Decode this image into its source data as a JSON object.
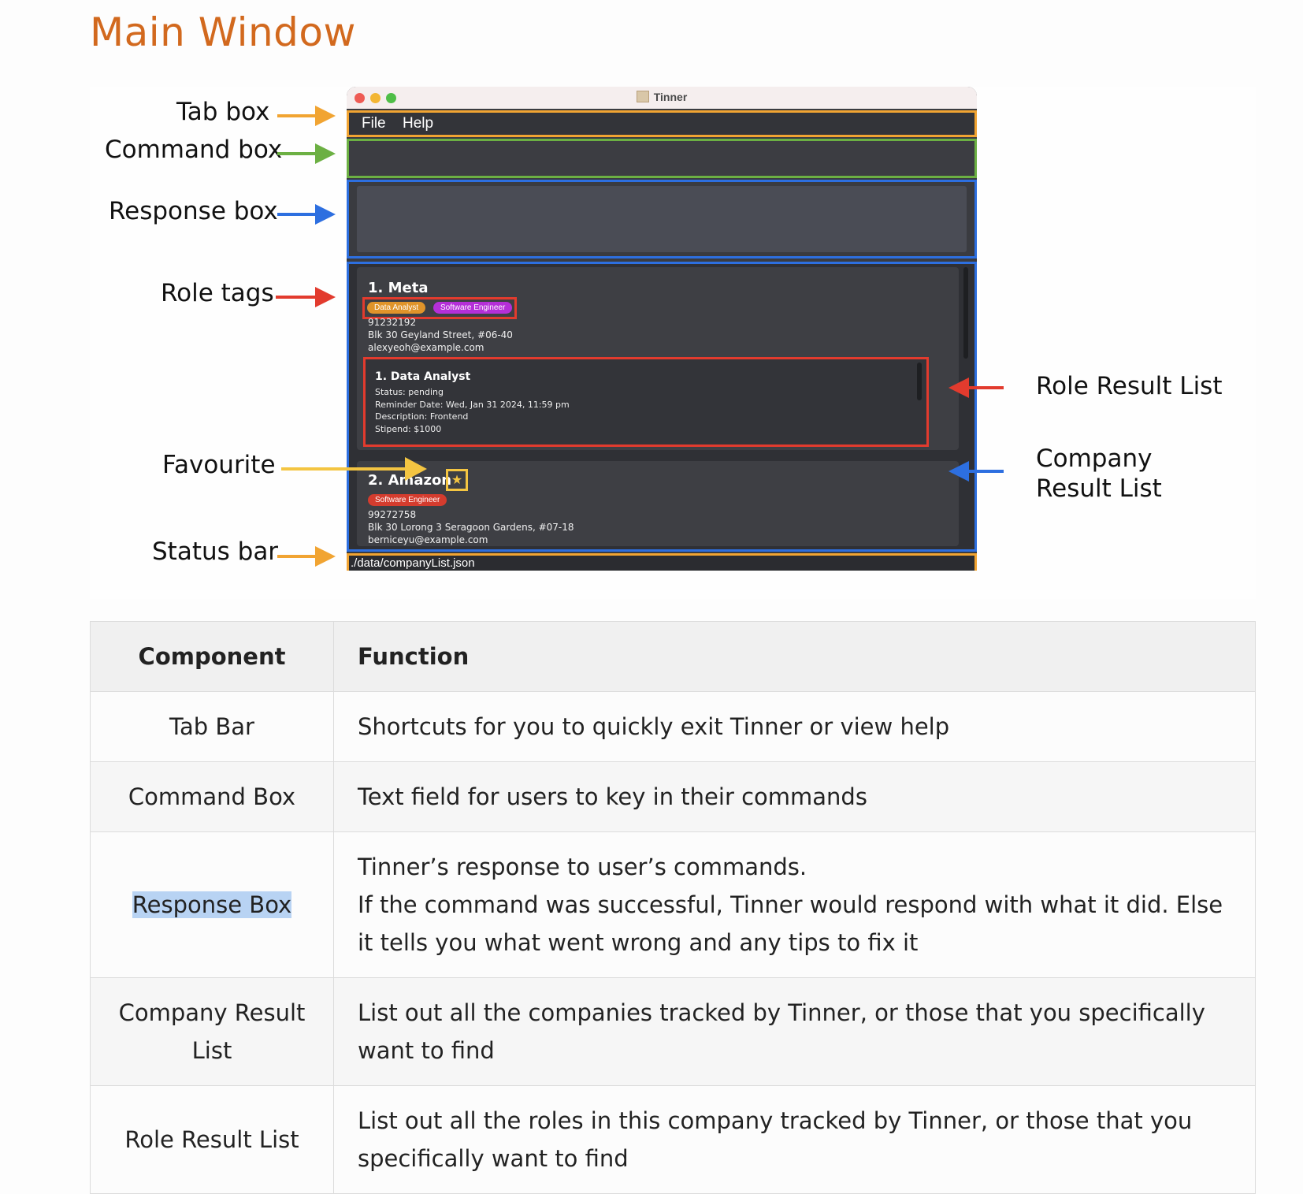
{
  "heading": "Main Window",
  "figure": {
    "window_title": "Tinner",
    "menu": [
      "File",
      "Help"
    ],
    "labels": {
      "tab_box": "Tab box",
      "command_box": "Command box",
      "response_box": "Response box",
      "role_tags": "Role tags",
      "favourite": "Favourite",
      "status_bar": "Status bar",
      "role_result_list": "Role Result List",
      "company_result_list_1": "Company",
      "company_result_list_2": "Result List"
    },
    "company1": {
      "name": "1.  Meta",
      "tags": [
        "Data Analyst",
        "Software Engineer"
      ],
      "phone": "91232192",
      "address": "Blk 30 Geyland Street, #06-40",
      "email": "alexyeoh@example.com",
      "role": {
        "title": "1.  Data Analyst",
        "status": "Status: pending",
        "reminder": "Reminder Date: Wed, Jan 31 2024, 11:59 pm",
        "description": "Description: Frontend",
        "stipend": "Stipend: $1000"
      }
    },
    "company2": {
      "name": "2.  Amazon",
      "tags": [
        "Software Engineer"
      ],
      "phone": "99272758",
      "address": "Blk 30 Lorong 3 Seragoon Gardens, #07-18",
      "email": "berniceyu@example.com"
    },
    "status_path": "./data/companyList.json",
    "star_glyph": "★"
  },
  "table": {
    "headers": [
      "Component",
      "Function"
    ],
    "rows": [
      {
        "component": "Tab Bar",
        "function": "Shortcuts for you to quickly exit Tinner or view help"
      },
      {
        "component": "Command Box",
        "function": "Text field for users to key in their commands"
      },
      {
        "component": "Response Box",
        "function_1": "Tinner’s response to user’s commands.",
        "function_2": "If the command was successful, Tinner would respond with what it did. Else it tells you what went wrong and any tips to fix it"
      },
      {
        "component_1": "Company Result",
        "component_2": "List",
        "function": "List out all the companies tracked by Tinner, or those that you specifically want to find"
      },
      {
        "component": "Role Result List",
        "function": "List out all the roles in this company tracked by Tinner, or those that you specifically want to find"
      }
    ]
  },
  "colors": {
    "heading": "#d2691e",
    "tab_box": "#f1a432",
    "command_box": "#6cb043",
    "response_box": "#2d6fe0",
    "role_tags": "#e23b2e",
    "favourite": "#f4c542",
    "selection_highlight": "#b8d3f3"
  }
}
